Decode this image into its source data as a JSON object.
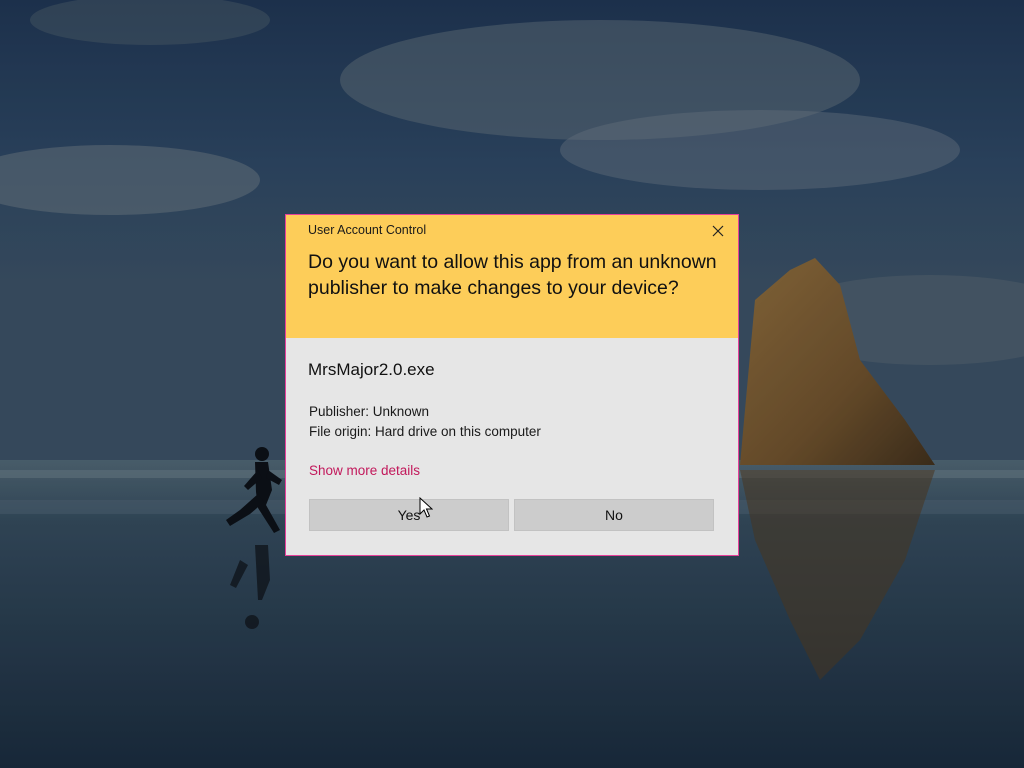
{
  "dialog": {
    "title": "User Account Control",
    "question": "Do you want to allow this app from an unknown publisher to make changes to your device?",
    "app_name": "MrsMajor2.0.exe",
    "publisher": "Publisher: Unknown",
    "origin": "File origin: Hard drive on this computer",
    "details_link": "Show more details",
    "yes_label": "Yes",
    "no_label": "No",
    "close_icon": "close-icon"
  },
  "colors": {
    "header": "#fdcd59",
    "border": "#e6409a",
    "body": "#e6e6e6",
    "link": "#c2185b",
    "button": "#cccccc"
  }
}
